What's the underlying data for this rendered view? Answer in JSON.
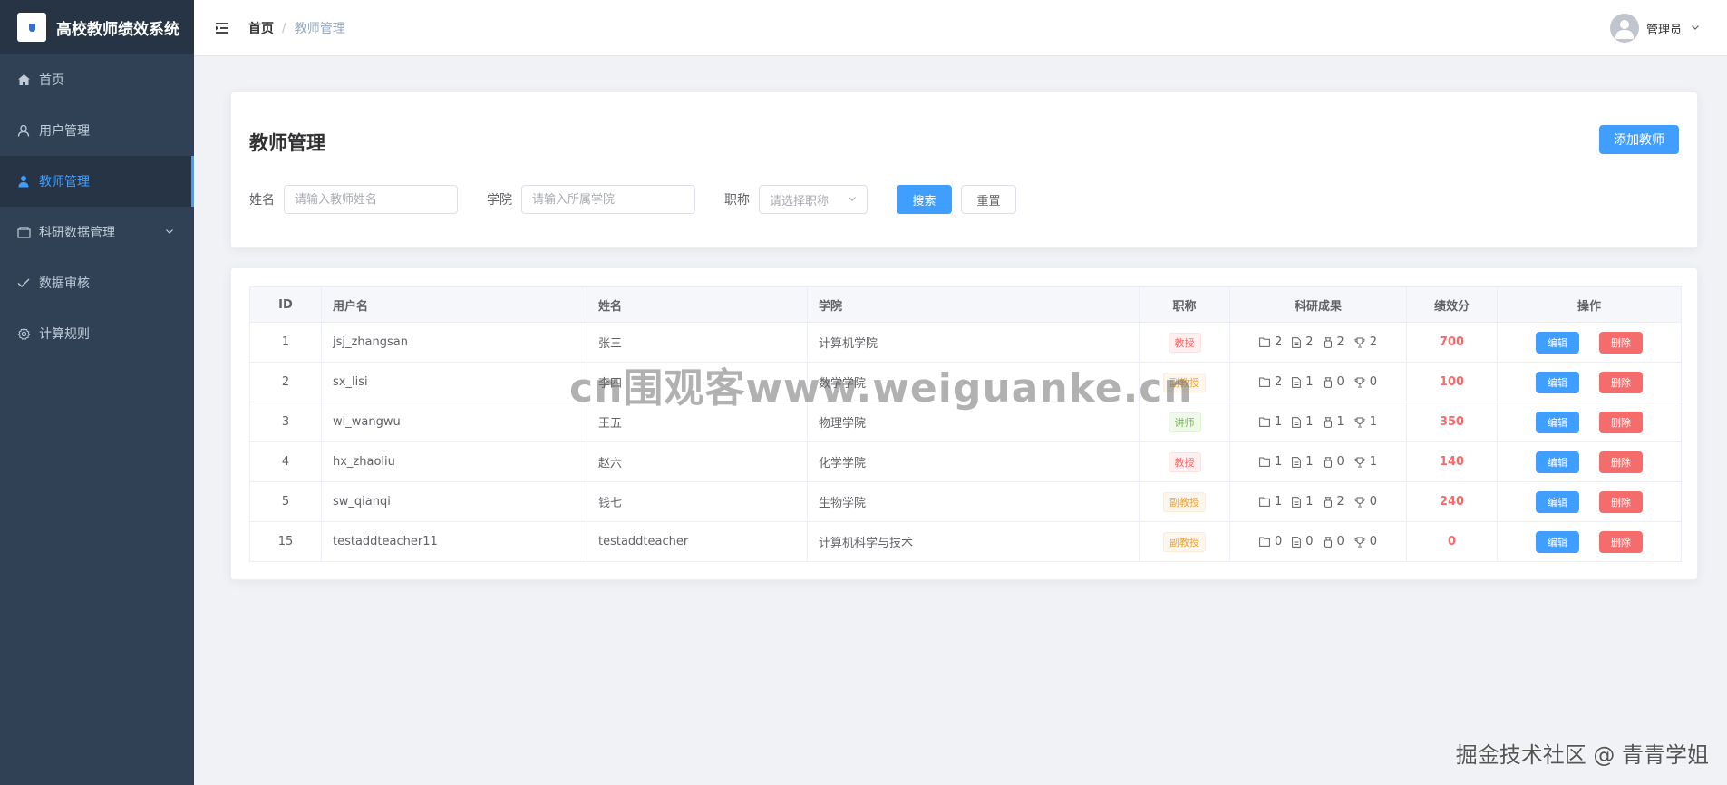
{
  "app": {
    "title": "高校教师绩效系统"
  },
  "sidebar": {
    "items": [
      {
        "label": "首页",
        "icon": "home-icon"
      },
      {
        "label": "用户管理",
        "icon": "user-icon"
      },
      {
        "label": "教师管理",
        "icon": "teacher-icon",
        "active": true
      },
      {
        "label": "科研数据管理",
        "icon": "folder-icon",
        "has_children": true
      },
      {
        "label": "数据审核",
        "icon": "check-icon"
      },
      {
        "label": "计算规则",
        "icon": "gear-icon"
      }
    ]
  },
  "header": {
    "breadcrumb": {
      "home": "首页",
      "separator": "/",
      "current": "教师管理"
    },
    "user_name": "管理员"
  },
  "page": {
    "title": "教师管理",
    "add_button": "添加教师",
    "search": {
      "name_label": "姓名",
      "name_placeholder": "请输入教师姓名",
      "college_label": "学院",
      "college_placeholder": "请输入所属学院",
      "title_label": "职称",
      "title_placeholder": "请选择职称",
      "search_button": "搜索",
      "reset_button": "重置"
    }
  },
  "table": {
    "columns": [
      "ID",
      "用户名",
      "姓名",
      "学院",
      "职称",
      "科研成果",
      "绩效分",
      "操作"
    ],
    "edit_label": "编辑",
    "delete_label": "删除",
    "rows": [
      {
        "id": "1",
        "username": "jsj_zhangsan",
        "name": "张三",
        "college": "计算机学院",
        "title": "教授",
        "title_type": "danger",
        "r1": "2",
        "r2": "2",
        "r3": "2",
        "r4": "2",
        "score": "700"
      },
      {
        "id": "2",
        "username": "sx_lisi",
        "name": "李四",
        "college": "数学学院",
        "title": "副教授",
        "title_type": "warning",
        "r1": "2",
        "r2": "1",
        "r3": "0",
        "r4": "0",
        "score": "100"
      },
      {
        "id": "3",
        "username": "wl_wangwu",
        "name": "王五",
        "college": "物理学院",
        "title": "讲师",
        "title_type": "success",
        "r1": "1",
        "r2": "1",
        "r3": "1",
        "r4": "1",
        "score": "350"
      },
      {
        "id": "4",
        "username": "hx_zhaoliu",
        "name": "赵六",
        "college": "化学学院",
        "title": "教授",
        "title_type": "danger",
        "r1": "1",
        "r2": "1",
        "r3": "0",
        "r4": "1",
        "score": "140"
      },
      {
        "id": "5",
        "username": "sw_qianqi",
        "name": "钱七",
        "college": "生物学院",
        "title": "副教授",
        "title_type": "warning",
        "r1": "1",
        "r2": "1",
        "r3": "2",
        "r4": "0",
        "score": "240"
      },
      {
        "id": "15",
        "username": "testaddteacher11",
        "name": "testaddteacher",
        "college": "计算机科学与技术",
        "title": "副教授",
        "title_type": "warning",
        "r1": "0",
        "r2": "0",
        "r3": "0",
        "r4": "0",
        "score": "0"
      }
    ]
  },
  "watermarks": {
    "center": "cn围观客www.weiguanke.cn",
    "bottom_right": "掘金技术社区 @ 青青学姐"
  },
  "colors": {
    "sidebar_bg": "#304156",
    "sidebar_active_bg": "#263445",
    "primary": "#409eff",
    "danger": "#f56c6c",
    "warning": "#e6a23c",
    "success": "#67c23a"
  }
}
